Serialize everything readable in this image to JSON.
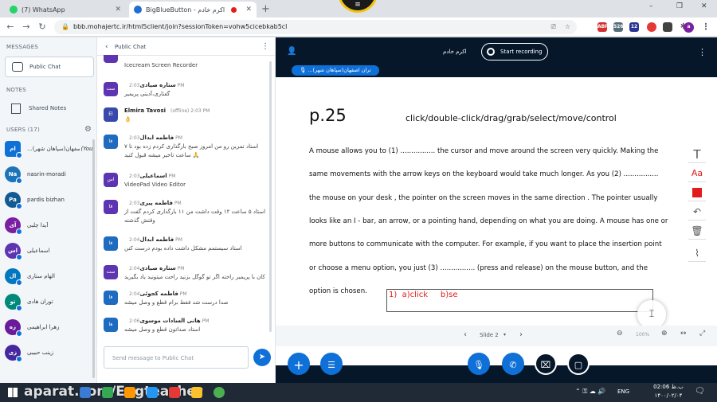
{
  "browser": {
    "tabs": [
      {
        "title": "(7) WhatsApp",
        "active": false
      },
      {
        "title": "BigBlueButton - اکرم خادم",
        "active": true
      }
    ],
    "new_tab": "+",
    "url": "bbb.mohajertc.ir/html5client/join?sessionToken=vohw5cicebkab5cl",
    "ext_badges": [
      "ABP",
      "5265",
      "12"
    ],
    "window_controls": [
      "–",
      "❐",
      "✕"
    ]
  },
  "nav": {
    "messages_title": "MESSAGES",
    "public_chat": "Public Chat",
    "notes_title": "NOTES",
    "shared_notes": "Shared Notes",
    "users_title": "USERS (17)",
    "users": [
      {
        "initials": "ام",
        "name": "...اصفهان(سپاهان شهر)",
        "you": "(You)",
        "color": "#0f70d7"
      },
      {
        "initials": "Na",
        "name": "nasrin-moradi",
        "you": "",
        "color": "#1d73b8"
      },
      {
        "initials": "Pa",
        "name": "pardis bizhan",
        "you": "",
        "color": "#125a93"
      },
      {
        "initials": "آی",
        "name": "آیدا چلبی",
        "you": "",
        "color": "#7b1fa2"
      },
      {
        "initials": "اس",
        "name": "اسماعیلی",
        "you": "",
        "color": "#5e35b1"
      },
      {
        "initials": "ال",
        "name": "الهام ستاری",
        "you": "",
        "color": "#0277bd"
      },
      {
        "initials": "تو",
        "name": "توران هادی",
        "you": "",
        "color": "#00897b"
      },
      {
        "initials": "زه",
        "name": "زهرا ابراهیمی",
        "you": "",
        "color": "#6a1b9a"
      },
      {
        "initials": "زی",
        "name": "زینب حبیبی",
        "you": "",
        "color": "#4527a0"
      }
    ]
  },
  "chat": {
    "title": "Public Chat",
    "messages": [
      {
        "avatar": "",
        "name": "",
        "time": "",
        "text": "Icecream Screen Recorder",
        "color": "#5e35b1"
      },
      {
        "avatar": "ست",
        "name": "ستاره صیادی",
        "time": "2:03 PM",
        "text": "گفتاری،آدیتی پریمیر",
        "color": "#5e35b1"
      },
      {
        "avatar": "El",
        "name": "Elmira Tavosi",
        "time": "(offline) 2:03 PM",
        "text": "👌",
        "color": "#3949ab"
      },
      {
        "avatar": "فا",
        "name": "فاطمه ابدال",
        "time": "2:03 PM",
        "text": "استاد تمرین رو من امروز صبح بارگذاری کردم زده بود تا ۷ ساعت تاخیر میشه قبول کنید 🙏",
        "color": "#1e6bbf"
      },
      {
        "avatar": "اس",
        "name": "اسماعیلی",
        "time": "2:03 PM",
        "text": "VideoPad Video Editor",
        "color": "#5e35b1"
      },
      {
        "avatar": "فا",
        "name": "فاطمه پیری",
        "time": "2:03 PM",
        "text": "استاد ۵ ساعت ۱۲ وقت داشت من ۱۱ بارگذاری کردم گفت از وقتش گذشته",
        "color": "#5e35b1"
      },
      {
        "avatar": "فا",
        "name": "فاطمه ابدال",
        "time": "2:04 PM",
        "text": "استاد سیستمم مشکل داشت داده بودم درست کنن",
        "color": "#1e6bbf"
      },
      {
        "avatar": "ست",
        "name": "ستاره صیادی",
        "time": "2:04 PM",
        "text": "کان با پریمیر راحته اگر تو گوگل بزنید راحت میتونید یاد بگیرید",
        "color": "#5e35b1"
      },
      {
        "avatar": "فا",
        "name": "فاطمه کجوئی",
        "time": "2:04 PM",
        "text": "صدا درست شد فقط برام قطع و وصل میشه",
        "color": "#1e6bbf"
      },
      {
        "avatar": "ها",
        "name": "هانی السادات موسوی",
        "time": "2:06 PM",
        "text": "استاد صداتون قطع و وصل میشه",
        "color": "#1e6bbf"
      }
    ],
    "input_placeholder": "Send message to Public Chat"
  },
  "presentation": {
    "presenter": "اکرم خادم",
    "talking_badge": "...تران اصفهان(سپاهان شهر)",
    "start_recording": "Start recording",
    "slide_nav": "Slide 2",
    "zoom": "100%",
    "page_label": "p.25",
    "header_words": "click/double-click/drag/grab/select/move/control",
    "paragraph": [
      "A mouse allows you to (1) ................ the cursor and move around the screen very quickly. Making the",
      "same movements with the arrow keys on the keyboard would take much longer. As you (2) ................",
      "the mouse on your desk , the pointer on the screen moves in the same direction . The pointer usually",
      "looks like an I - bar, an arrow, or a pointing hand, depending on what you are doing. A mouse has one or",
      "more buttons to communicate with the computer. For example, if you want to place the insertion point",
      "or choose a menu option, you just (3) ................  (press and release) on the mouse button, and the",
      "option is chosen."
    ],
    "typed_answer": "1)  a)click     b)se"
  },
  "taskbar": {
    "watermark": "aparat.com/Engteacher",
    "lang": "ENG",
    "time": "02:06 ب.ظ",
    "date": "۱۴۰۰/۰۲/۰۴"
  },
  "colors": {
    "accent": "#0f70d7",
    "pres_bg": "#06172a",
    "record_red": "#e21b1b"
  }
}
